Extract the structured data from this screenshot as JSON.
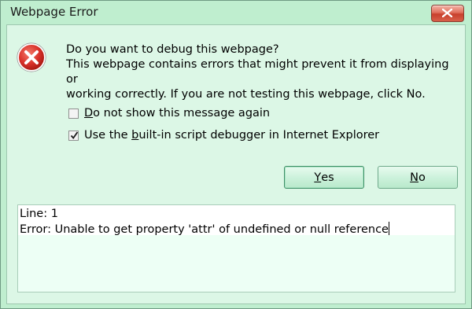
{
  "window": {
    "title": "Webpage Error"
  },
  "message": {
    "line1": "Do you want to debug this webpage?",
    "line2": "This webpage contains errors that might prevent it from displaying or",
    "line3": "working correctly. If you are not testing this webpage, click No."
  },
  "options": {
    "do_not_show": {
      "label_prefix": "",
      "accel": "D",
      "label_rest": "o not show this message again",
      "checked": false
    },
    "use_debugger": {
      "label_prefix": "Use the ",
      "accel": "b",
      "label_rest": "uilt-in script debugger in Internet Explorer",
      "checked": true
    }
  },
  "buttons": {
    "yes": {
      "accel": "Y",
      "rest": "es"
    },
    "no": {
      "accel": "N",
      "rest": "o"
    }
  },
  "details": {
    "line": "Line: 1",
    "error": "Error: Unable to get property 'attr' of undefined or null reference"
  },
  "colors": {
    "frame": "#bfeecf",
    "client": "#dcf7e6",
    "close": "#c8402c",
    "error_icon": "#d9312a"
  },
  "icons": [
    "close-icon",
    "error-icon",
    "checkbox-unchecked",
    "checkmark-icon"
  ]
}
